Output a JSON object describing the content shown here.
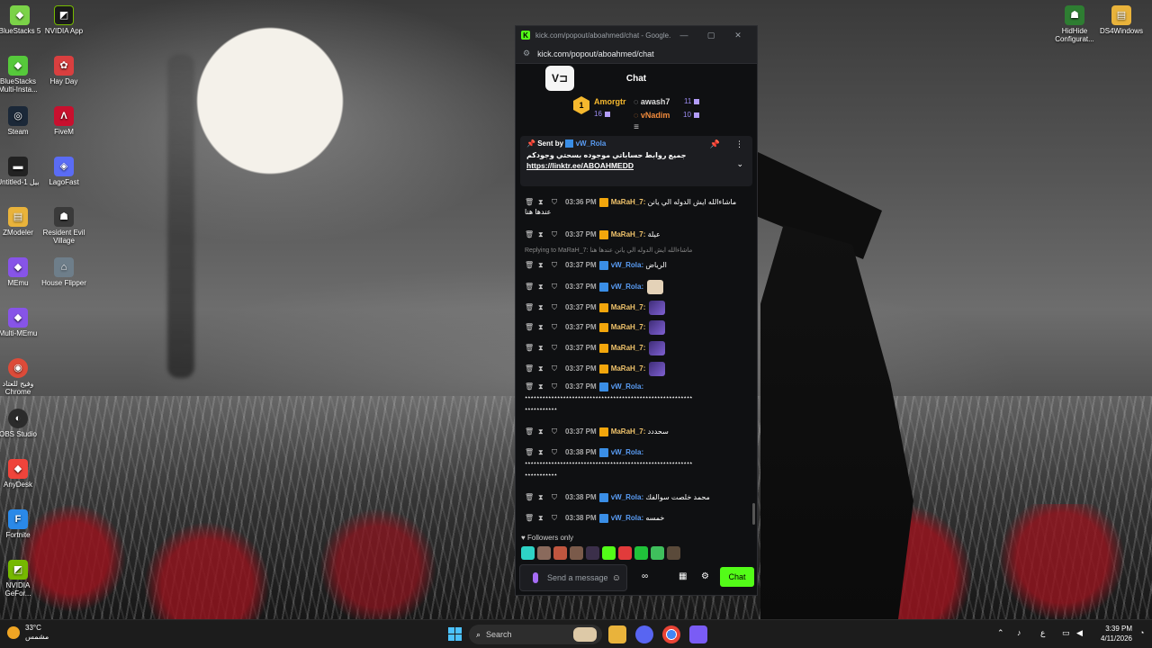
{
  "desktop": {
    "icons_left": [
      {
        "label": "BlueStacks 5",
        "color": "#7bd248",
        "glyph": "◆"
      },
      {
        "label": "NVIDIA App",
        "color": "#1b1b1b",
        "glyph": "◩"
      },
      {
        "label": "BlueStacks Multi-Insta...",
        "color": "#56c93b",
        "glyph": "◆"
      },
      {
        "label": "Hay Day",
        "color": "#d93f3f",
        "glyph": "✿"
      },
      {
        "label": "Steam",
        "color": "#1b2838",
        "glyph": "◎"
      },
      {
        "label": "FiveM",
        "color": "#c8102e",
        "glyph": "Λ"
      },
      {
        "label": "Untitled-1 بيل",
        "color": "#222222",
        "glyph": "▬"
      },
      {
        "label": "LagoFast",
        "color": "#5a6cf5",
        "glyph": "◈"
      },
      {
        "label": "ZModeler",
        "color": "#e9b33b",
        "glyph": "▤"
      },
      {
        "label": "Resident Evil Village",
        "color": "#3a3a3a",
        "glyph": "☗"
      },
      {
        "label": "MEmu",
        "color": "#8754e8",
        "glyph": "◆"
      },
      {
        "label": "House Flipper",
        "color": "#6e7e8a",
        "glyph": "⌂"
      },
      {
        "label": "Multi-MEmu",
        "color": "#8754e8",
        "glyph": "◆"
      },
      {
        "label": "وفيج للعتاد Chrome",
        "color": "#dd4b39",
        "glyph": "◉"
      },
      {
        "label": "OBS Studio",
        "color": "#2b2b2b",
        "glyph": "◐"
      },
      {
        "label": "AnyDesk",
        "color": "#ef443b",
        "glyph": "◆"
      },
      {
        "label": "Fortnite",
        "color": "#2a89e8",
        "glyph": "F"
      },
      {
        "label": "NVIDIA GeFor...",
        "color": "#76b900",
        "glyph": "◩"
      }
    ],
    "icons_right": [
      {
        "label": "HidHide Configurat...",
        "color": "#2e7d32",
        "glyph": "☗"
      },
      {
        "label": "DS4Windows",
        "color": "#e9b33b",
        "glyph": "▤"
      }
    ]
  },
  "browser": {
    "title": "kick.com/popout/aboahmed/chat - Google...",
    "url": "kick.com/popout/aboahmed/chat",
    "window_controls": {
      "minimize": "—",
      "maximize": "▢",
      "close": "✕"
    }
  },
  "chat": {
    "header_title": "Chat",
    "logo_text": "V⊐",
    "leaderboard": {
      "first": {
        "rank": "1",
        "name": "Amorgtr",
        "count": "16"
      },
      "second": {
        "name": "awash7",
        "count": "11"
      },
      "third": {
        "name": "vNadim",
        "count": "10"
      },
      "toggle": "≡"
    },
    "pinned": {
      "sent_by_label": "Sent by",
      "user": "vW_Rola",
      "message": "جميع روابط حساباتي موجوده بسحتي وجودكم",
      "link": "https://linktr.ee/ABOAHMEDD",
      "pin_icon": "📌",
      "more_icon": "⋮",
      "collapse_icon": "⌄"
    },
    "messages": [
      {
        "time": "03:36 PM",
        "user": "MaRaH_7",
        "badge": "crown",
        "text": "ماشاءالله ايش الدوله الي يانن",
        "wrap": "عندها هنا"
      },
      {
        "time": "03:37 PM",
        "user": "MaRaH_7",
        "badge": "crown",
        "text": "عيلة"
      },
      {
        "reply": "Replying to MaRaH_7: ماشاءالله ايش الدوله الي يانن عندها هنا"
      },
      {
        "time": "03:37 PM",
        "user": "vW_Rola",
        "badge": "verify",
        "text": "الرياض"
      },
      {
        "time": "03:37 PM",
        "user": "vW_Rola",
        "badge": "verify",
        "text": "",
        "emote": "cat"
      },
      {
        "time": "03:37 PM",
        "user": "MaRaH_7",
        "badge": "crown",
        "text": "",
        "emote": "purple"
      },
      {
        "time": "03:37 PM",
        "user": "MaRaH_7",
        "badge": "crown",
        "text": "",
        "emote": "purple"
      },
      {
        "time": "03:37 PM",
        "user": "MaRaH_7",
        "badge": "crown",
        "text": "",
        "emote": "purple"
      },
      {
        "time": "03:37 PM",
        "user": "MaRaH_7",
        "badge": "crown",
        "text": "",
        "emote": "purple"
      },
      {
        "time": "03:37 PM",
        "user": "vW_Rola",
        "badge": "verify",
        "text": "",
        "wrap": "٭٭٭٭٭٭٭٭٭٭٭٭٭٭٭٭٭٭٭٭٭٭٭٭٭٭٭٭٭٭٭٭٭٭٭٭٭٭٭٭٭٭٭٭٭٭٭٭٭٭٭٭٭٭٭٭٭",
        "wrap2": "٭٭٭٭٭٭٭٭٭٭٭"
      },
      {
        "time": "03:37 PM",
        "user": "MaRaH_7",
        "badge": "crown",
        "text": "سحددد"
      },
      {
        "time": "03:38 PM",
        "user": "vW_Rola",
        "badge": "verify",
        "text": "",
        "wrap": "٭٭٭٭٭٭٭٭٭٭٭٭٭٭٭٭٭٭٭٭٭٭٭٭٭٭٭٭٭٭٭٭٭٭٭٭٭٭٭٭٭٭٭٭٭٭٭٭٭٭٭٭٭٭٭٭٭",
        "wrap2": "٭٭٭٭٭٭٭٭٭٭٭"
      },
      {
        "time": "03:38 PM",
        "user": "vW_Rola",
        "badge": "verify",
        "text": "محمد خلصت سوالفك"
      },
      {
        "time": "03:38 PM",
        "user": "vW_Rola",
        "badge": "verify",
        "text": "خمسه"
      }
    ],
    "followers_only": "Followers only",
    "input_placeholder": "Send a message",
    "send_button": "Chat"
  },
  "taskbar": {
    "weather_temp": "33°C",
    "weather_desc": "مشمس",
    "search_label": "Search",
    "time": "3:39 PM",
    "date": "4/11/2026",
    "lang": "ع"
  }
}
